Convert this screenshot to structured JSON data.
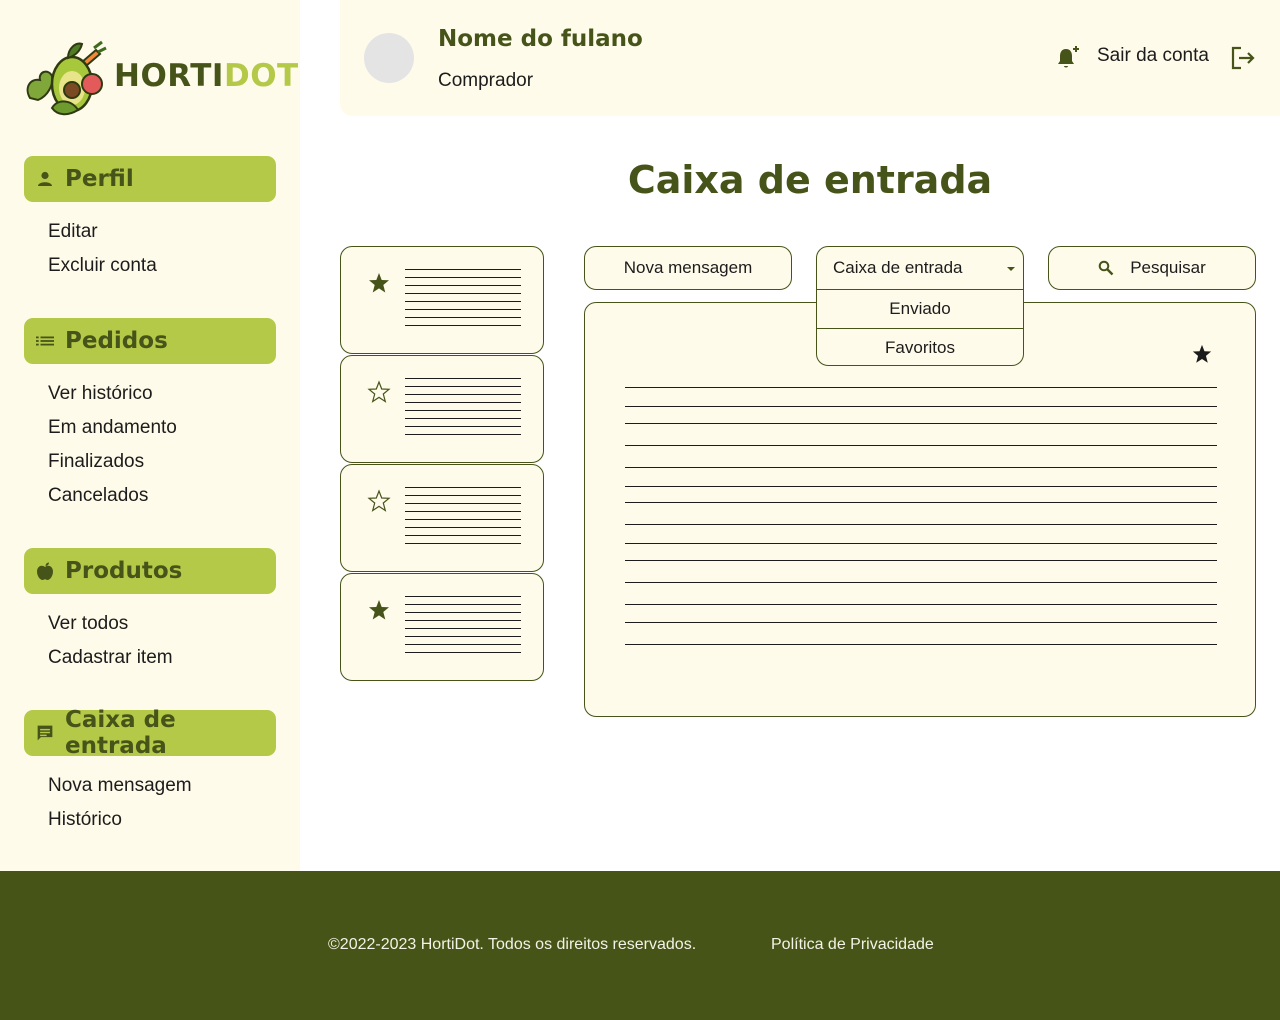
{
  "brand": {
    "name_part1": "HORTI",
    "name_part2": "DOT",
    "primary_color": "#46541a",
    "accent_color": "#b5c948",
    "bg_color": "#fffbea"
  },
  "sidebar": {
    "sections": [
      {
        "title": "Perfil",
        "icon": "person-icon",
        "links": [
          "Editar",
          "Excluir conta"
        ]
      },
      {
        "title": "Pedidos",
        "icon": "list-icon",
        "links": [
          "Ver histórico",
          "Em andamento",
          "Finalizados",
          "Cancelados"
        ]
      },
      {
        "title": "Produtos",
        "icon": "apple-icon",
        "links": [
          "Ver todos",
          "Cadastrar item"
        ]
      },
      {
        "title": "Caixa de entrada",
        "icon": "chat-icon",
        "links": [
          "Nova mensagem",
          "Histórico"
        ]
      }
    ]
  },
  "header": {
    "user_name": "Nome do fulano",
    "user_role": "Comprador",
    "logout_label": "Sair da conta"
  },
  "main": {
    "title": "Caixa de entrada",
    "new_message_label": "Nova mensagem",
    "search_label": "Pesquisar",
    "folder_select": {
      "selected": "Caixa de entrada",
      "options": [
        "Enviado",
        "Favoritos"
      ]
    },
    "message_cards": [
      {
        "starred": true
      },
      {
        "starred": false
      },
      {
        "starred": false
      },
      {
        "starred": true
      }
    ],
    "open_message": {
      "starred": true
    }
  },
  "footer": {
    "copyright": "©2022-2023 HortiDot. Todos os direitos reservados.",
    "privacy_link": "Política de Privacidade"
  }
}
